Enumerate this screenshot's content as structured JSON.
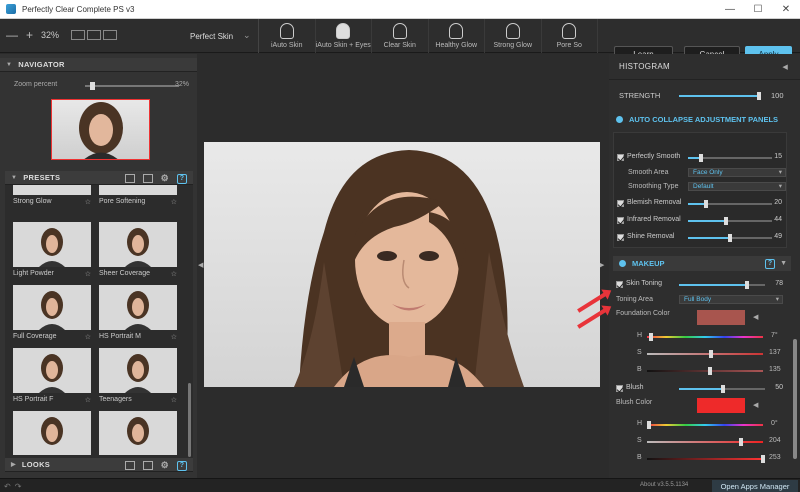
{
  "window": {
    "title": "Perfectly Clear Complete PS v3",
    "controls": [
      "—",
      "☐",
      "✕"
    ]
  },
  "toolbar": {
    "zoom_minus": "—",
    "zoom_plus": "+",
    "zoom_value": "32%",
    "preset_name": "Perfect Skin",
    "skin_buttons": [
      {
        "label": "iAuto Skin",
        "icon": "face-outline-icon"
      },
      {
        "label": "iAuto Skin + Eyes",
        "icon": "face-filled-icon"
      },
      {
        "label": "Clear Skin",
        "icon": "face-clear-icon"
      },
      {
        "label": "Healthy Glow",
        "icon": "face-glow-icon"
      },
      {
        "label": "Strong Glow",
        "icon": "face-strong-glow-icon"
      },
      {
        "label": "Pore So",
        "icon": "face-pore-icon"
      }
    ],
    "learn": "Learn",
    "cancel": "Cancel",
    "apply": "Apply"
  },
  "navigator": {
    "title": "NAVIGATOR",
    "zoom_label": "Zoom percent",
    "zoom_value": "32%",
    "zoom_fraction": 0.1
  },
  "presets": {
    "title": "PRESETS",
    "items": [
      {
        "label": "Strong Glow"
      },
      {
        "label": "Pore Softening"
      },
      {
        "label": "Light Powder"
      },
      {
        "label": "Sheer Coverage"
      },
      {
        "label": "Full Coverage"
      },
      {
        "label": "HS Portrait M"
      },
      {
        "label": "HS Portrait F"
      },
      {
        "label": "Teenagers"
      }
    ],
    "star": "☆"
  },
  "looks": {
    "title": "LOOKS"
  },
  "right": {
    "histogram": "HISTOGRAM",
    "strength_label": "STRENGTH",
    "strength_value": "100",
    "auto_collapse": "AUTO COLLAPSE ADJUSTMENT PANELS",
    "skin": {
      "perfectly_smooth": {
        "label": "Perfectly Smooth",
        "value": "15"
      },
      "smooth_area": {
        "label": "Smooth Area",
        "value": "Face Only"
      },
      "smoothing_type": {
        "label": "Smoothing Type",
        "value": "Default"
      },
      "blemish": {
        "label": "Blemish Removal",
        "value": "20"
      },
      "infrared": {
        "label": "Infrared Removal",
        "value": "44"
      },
      "shine": {
        "label": "Shine Removal",
        "value": "49"
      }
    },
    "makeup": {
      "title": "MAKEUP",
      "skin_toning": {
        "label": "Skin Toning",
        "value": "78"
      },
      "toning_area": {
        "label": "Toning Area",
        "value": "Full Body"
      },
      "foundation_color": {
        "label": "Foundation Color",
        "color": "#a8554e"
      },
      "foundation_hsb": {
        "h": "7°",
        "s": "137",
        "b": "135"
      },
      "blush": {
        "label": "Blush",
        "value": "50"
      },
      "blush_color": {
        "label": "Blush Color",
        "color": "#ee2a2a"
      },
      "blush_hsb": {
        "h": "0°",
        "s": "204",
        "b": "253"
      },
      "hsb_labels": {
        "h": "H",
        "s": "S",
        "b": "B"
      }
    }
  },
  "status": {
    "about": "About v3.5.5.1134",
    "open_apps": "Open Apps Manager"
  },
  "colors": {
    "accent": "#5ec2ee",
    "arrow": "#e8343a"
  }
}
